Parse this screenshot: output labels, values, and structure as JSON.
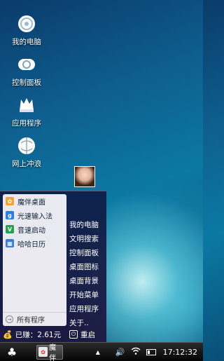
{
  "desktop": {
    "icons": [
      {
        "label": "我的电脑",
        "icon": "computer-icon"
      },
      {
        "label": "控制面板",
        "icon": "control-panel-icon"
      },
      {
        "label": "应用程序",
        "icon": "applications-icon"
      },
      {
        "label": "网上冲浪",
        "icon": "browser-icon"
      }
    ]
  },
  "start_menu": {
    "apps": [
      {
        "label": "魔伴桌面",
        "icon": "mobo-desktop-icon",
        "color": "#3a8ee6"
      },
      {
        "label": "光速输入法",
        "icon": "input-method-icon",
        "color": "#2c7de0"
      },
      {
        "label": "音速启动",
        "icon": "quick-launch-icon",
        "color": "#2aa04a"
      },
      {
        "label": "哈哈日历",
        "icon": "calendar-icon",
        "color": "#3b7fd0"
      }
    ],
    "all_programs": "所有程序",
    "shortcuts": [
      "我的电脑",
      "文明搜索",
      "控制面板",
      "桌面图标",
      "桌面背景",
      "开始菜单",
      "应用程序",
      "关于.."
    ],
    "earned": "已赚：2.61元",
    "restart": "重启"
  },
  "taskbar": {
    "start_icon": "clover-icon",
    "task_label": "魔伴",
    "clock": "17:12:32"
  }
}
